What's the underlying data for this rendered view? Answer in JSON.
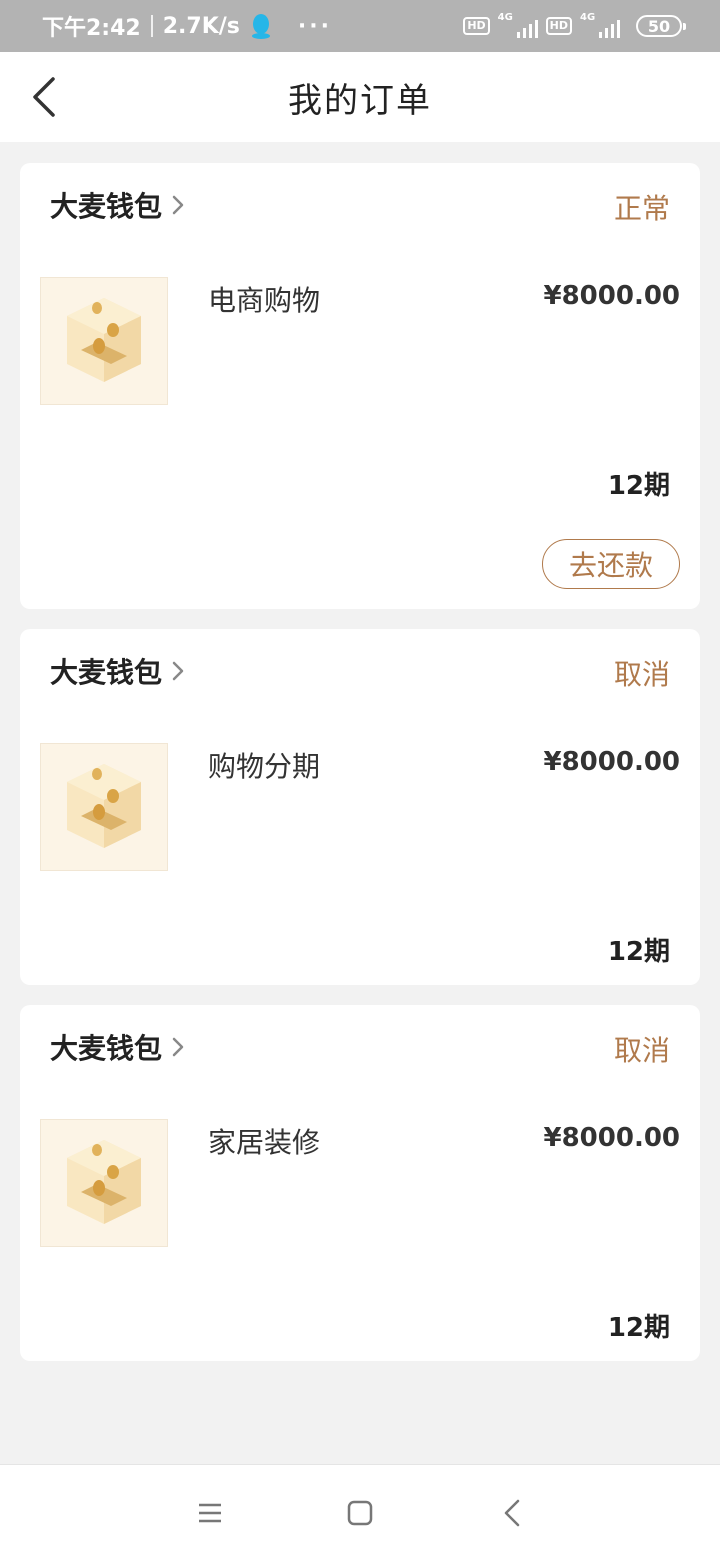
{
  "status_bar": {
    "time": "下午2:42",
    "speed": "2.7K/s",
    "more": "···",
    "hd1": "HD",
    "sig1": "4G",
    "hd2": "HD",
    "sig2": "4G",
    "battery": "50"
  },
  "header": {
    "title": "我的订单"
  },
  "orders": [
    {
      "merchant": "大麦钱包",
      "status": "正常",
      "product": "电商购物",
      "price": "¥8000.00",
      "period": "12期",
      "action": "去还款"
    },
    {
      "merchant": "大麦钱包",
      "status": "取消",
      "product": "购物分期",
      "price": "¥8000.00",
      "period": "12期"
    },
    {
      "merchant": "大麦钱包",
      "status": "取消",
      "product": "家居装修",
      "price": "¥8000.00",
      "period": "12期"
    }
  ],
  "colors": {
    "accent": "#b07a4c",
    "status_bar_bg": "#b3b3b3",
    "page_bg": "#f2f2f2"
  },
  "icons": {
    "back": "chevron-left-icon",
    "merchant_arrow": "chevron-right-icon",
    "thumb": "coin-box-icon",
    "nav_menu": "menu-icon",
    "nav_home": "home-square-icon",
    "nav_back": "back-icon"
  }
}
